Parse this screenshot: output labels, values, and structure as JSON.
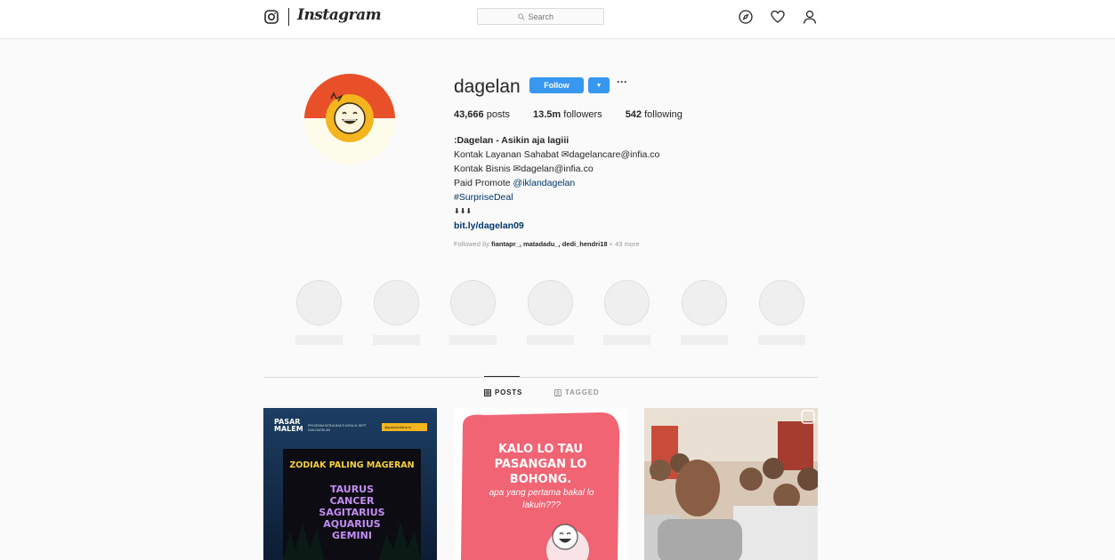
{
  "nav": {
    "wordmark": "Instagram",
    "search_placeholder": "Search",
    "icons": [
      "instagram-camera-icon",
      "search-icon",
      "compass-icon",
      "heart-icon",
      "user-icon"
    ]
  },
  "profile": {
    "username": "dagelan",
    "follow_label": "Follow",
    "more_label": "···",
    "stats": {
      "posts": "43,666",
      "posts_label": "posts",
      "followers": "13.5m",
      "followers_label": "followers",
      "following": "542",
      "following_label": "following"
    },
    "bio": {
      "name": ":Dagelan - Asikin aja lagiii",
      "line1_prefix": "Kontak Layanan Sahabat ",
      "line1_email": "dagelancare@infia.co",
      "line2_prefix": "Kontak Bisnis ",
      "line2_email": "dagelan@infia.co",
      "line3_prefix": "Paid Promote ",
      "line3_mention": "@iklandagelan",
      "line4_hashtag": "#SurpriseDeal",
      "line5_arrows": "⬇⬇⬇",
      "website": "bit.ly/dagelan09"
    },
    "followed_by": {
      "prefix": "Followed by ",
      "users": "fiantapr_, matadadu_, dedi_hendri18",
      "more": " + 43 more"
    }
  },
  "highlights_count": 7,
  "tabs": {
    "posts": "POSTS",
    "tagged": "TAGGED"
  },
  "posts": [
    {
      "label": "PASAR MALEM",
      "small_text": "PROGRAM KERJA BAKTI INFIA 31 SEPT DAN DAGELAN",
      "tag": "@pasarmalem.tv",
      "title": "ZODIAK PALING MAGERAN",
      "items": [
        "TAURUS",
        "CANCER",
        "SAGITARIUS",
        "AQUARIUS",
        "GEMINI"
      ]
    },
    {
      "headline": "KALO LO TAU PASANGAN LO BOHONG.",
      "sub": "apa yang pertama bakal lo lakuin???"
    },
    {
      "type": "video"
    }
  ],
  "colors": {
    "accent": "#3897f0",
    "link": "#003569",
    "avatar_red": "#e8502a",
    "avatar_yellow": "#f5b51e",
    "post1_bg": "#17304f",
    "post2_bg": "#f06474",
    "post3_bg": "#c9b8a6"
  }
}
